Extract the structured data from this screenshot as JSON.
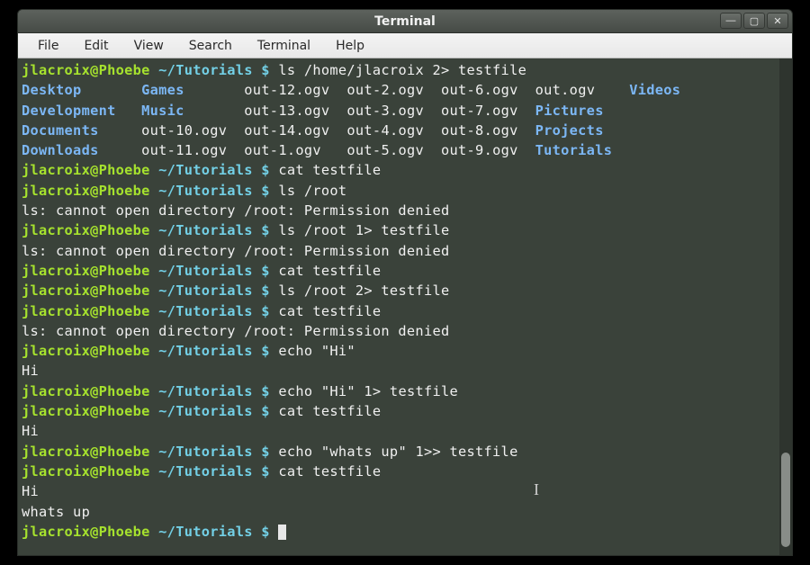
{
  "window": {
    "title": "Terminal",
    "controls": {
      "min": "—",
      "max": "▢",
      "close": "✕"
    }
  },
  "menubar": [
    "File",
    "Edit",
    "View",
    "Search",
    "Terminal",
    "Help"
  ],
  "prompt": {
    "user": "jlacroix@Phoebe",
    "path": "~/Tutorials",
    "sigil": "$"
  },
  "session": [
    {
      "t": "prompt",
      "cmd": "ls /home/jlacroix 2> testfile"
    },
    {
      "t": "ls",
      "cols": [
        [
          "Desktop",
          "Development",
          "Documents",
          "Downloads"
        ],
        [
          "Games",
          "Music",
          "out-10.ogv",
          "out-11.ogv"
        ],
        [
          "out-12.ogv",
          "out-13.ogv",
          "out-14.ogv",
          "out-1.ogv"
        ],
        [
          "out-2.ogv",
          "out-3.ogv",
          "out-4.ogv",
          "out-5.ogv"
        ],
        [
          "out-6.ogv",
          "out-7.ogv",
          "out-8.ogv",
          "out-9.ogv"
        ],
        [
          "out.ogv",
          "Pictures",
          "Projects",
          "Tutorials"
        ],
        [
          "Videos",
          "",
          "",
          ""
        ]
      ],
      "dirMap": {
        "Desktop": 1,
        "Development": 1,
        "Documents": 1,
        "Downloads": 1,
        "Games": 1,
        "Music": 1,
        "Pictures": 1,
        "Projects": 1,
        "Tutorials": 1,
        "Videos": 1
      }
    },
    {
      "t": "prompt",
      "cmd": "cat testfile"
    },
    {
      "t": "prompt",
      "cmd": "ls /root"
    },
    {
      "t": "out",
      "text": "ls: cannot open directory /root: Permission denied"
    },
    {
      "t": "prompt",
      "cmd": "ls /root 1> testfile"
    },
    {
      "t": "out",
      "text": "ls: cannot open directory /root: Permission denied"
    },
    {
      "t": "prompt",
      "cmd": "cat testfile"
    },
    {
      "t": "prompt",
      "cmd": "ls /root 2> testfile"
    },
    {
      "t": "prompt",
      "cmd": "cat testfile"
    },
    {
      "t": "out",
      "text": "ls: cannot open directory /root: Permission denied"
    },
    {
      "t": "prompt",
      "cmd": "echo \"Hi\""
    },
    {
      "t": "out",
      "text": "Hi"
    },
    {
      "t": "prompt",
      "cmd": "echo \"Hi\" 1> testfile"
    },
    {
      "t": "prompt",
      "cmd": "cat testfile"
    },
    {
      "t": "out",
      "text": "Hi"
    },
    {
      "t": "prompt",
      "cmd": "echo \"whats up\" 1>> testfile"
    },
    {
      "t": "prompt",
      "cmd": "cat testfile"
    },
    {
      "t": "out",
      "text": "Hi"
    },
    {
      "t": "out",
      "text": "whats up"
    },
    {
      "t": "prompt",
      "cmd": "",
      "cursor": true
    }
  ]
}
